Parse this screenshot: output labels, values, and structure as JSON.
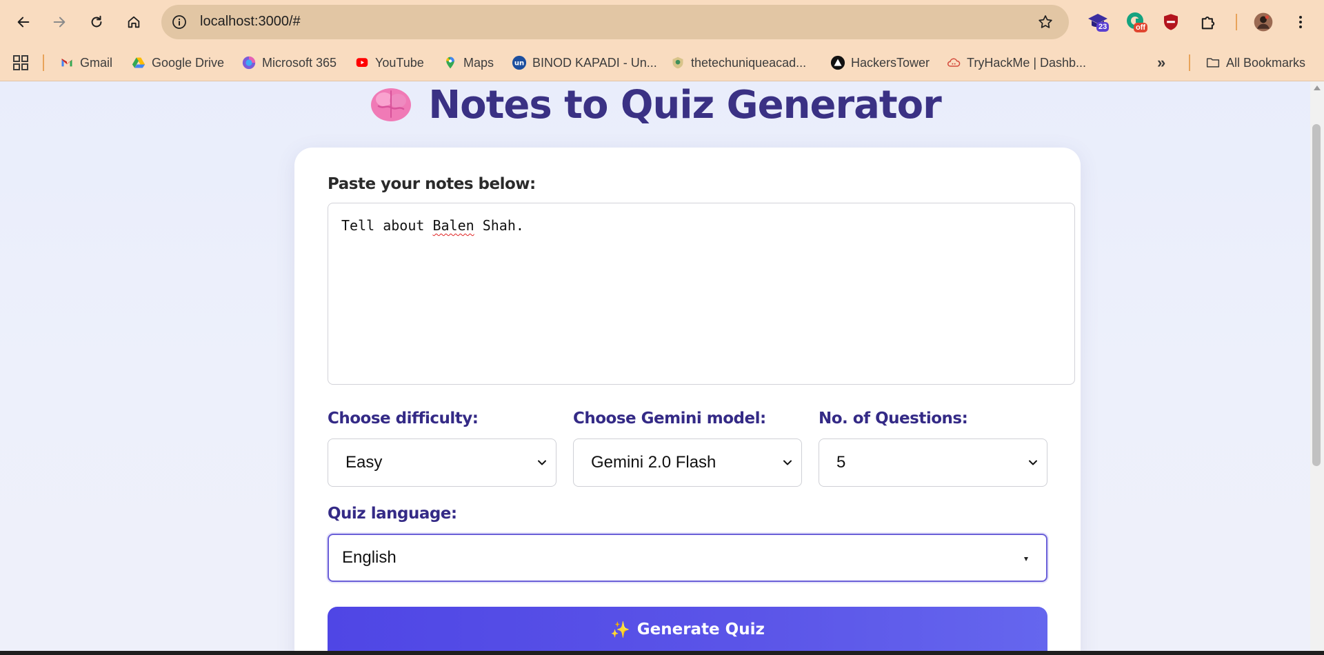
{
  "browser": {
    "url": "localhost:3000/#",
    "extensions": {
      "first_badge": "23",
      "second_badge": "off"
    },
    "bookmarks": [
      {
        "label": "Gmail",
        "icon": "gmail-icon"
      },
      {
        "label": "Google Drive",
        "icon": "google-drive-icon"
      },
      {
        "label": "Microsoft 365",
        "icon": "microsoft-365-icon"
      },
      {
        "label": "YouTube",
        "icon": "youtube-icon"
      },
      {
        "label": "Maps",
        "icon": "maps-icon"
      },
      {
        "label": "BINOD KAPADI - Un...",
        "icon": "unstop-icon"
      },
      {
        "label": "thetechuniqueacad...",
        "icon": "shield-logo-icon"
      },
      {
        "label": "HackersTower",
        "icon": "triangle-logo-icon"
      },
      {
        "label": "TryHackMe | Dashb...",
        "icon": "cloud-icon"
      }
    ],
    "more_bookmarks": "»",
    "all_bookmarks": "All Bookmarks"
  },
  "page": {
    "title_emoji": "🧠",
    "title": "Notes to Quiz Generator",
    "notes_label": "Paste your notes below:",
    "notes_text_before": "Tell about ",
    "notes_text_misspelled": "Balen",
    "notes_text_after": " Shah.",
    "difficulty_label": "Choose difficulty:",
    "difficulty_value": "Easy",
    "model_label": "Choose Gemini model:",
    "model_value": "Gemini 2.0 Flash",
    "questions_label": "No. of Questions:",
    "questions_value": "5",
    "language_label": "Quiz language:",
    "language_value": "English",
    "generate_icon": "✨",
    "generate_label": "Generate Quiz"
  },
  "colors": {
    "chrome": "#f9dcc0",
    "omnibox": "#e2c6a4",
    "title": "#3a3184",
    "accent": "#4f46e5",
    "label_purple": "#342a86"
  }
}
